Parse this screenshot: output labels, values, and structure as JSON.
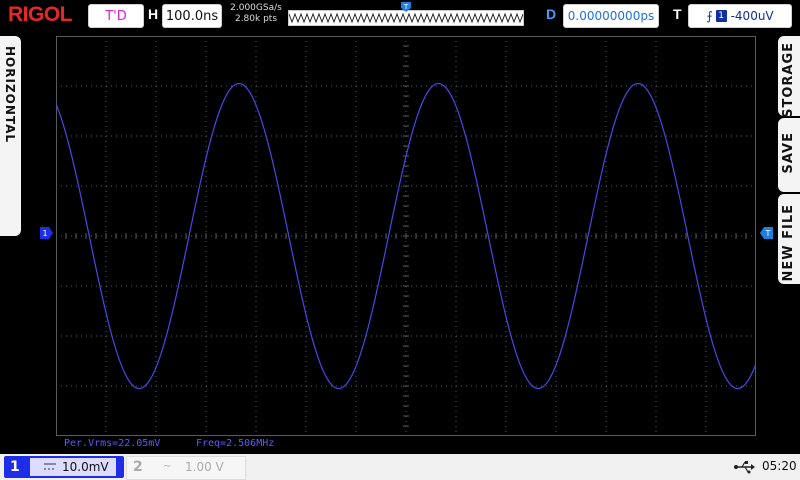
{
  "brand": "RIGOL",
  "status": {
    "run_state": "T'D"
  },
  "horizontal": {
    "label": "H",
    "timebase": "100.0ns",
    "sample_rate": "2.000GSa/s",
    "memory_depth": "2.80k pts"
  },
  "delay": {
    "label": "D",
    "value": "0.00000000ps"
  },
  "trigger": {
    "label": "T",
    "source": "1",
    "level": "-400uV"
  },
  "left_menu": {
    "horizontal_tab": "HORIZONTAL"
  },
  "right_menu": {
    "storage": "STORAGE",
    "save": "SAVE",
    "new_file": "NEW FILE"
  },
  "markers": {
    "ch1": "1",
    "trig": "T"
  },
  "measurements": {
    "vrms": "Per.Vrms=22.05mV",
    "freq": "Freq=2.506MHz"
  },
  "channels": [
    {
      "number": "1",
      "coupling": "DC",
      "scale": "10.0mV",
      "active": true
    },
    {
      "number": "2",
      "coupling": "AC",
      "scale": "1.00 V",
      "active": false
    }
  ],
  "system": {
    "time": "05:20",
    "usb_icon": "usb-icon"
  },
  "colors": {
    "ch1": "#4848e8",
    "grid": "#5a5a5a",
    "brand": "#e8262a"
  },
  "waveform": {
    "frequency_mhz": 2.506,
    "amplitude_div": 3.05,
    "offset_div": 0.0,
    "phase_deg": 150
  }
}
